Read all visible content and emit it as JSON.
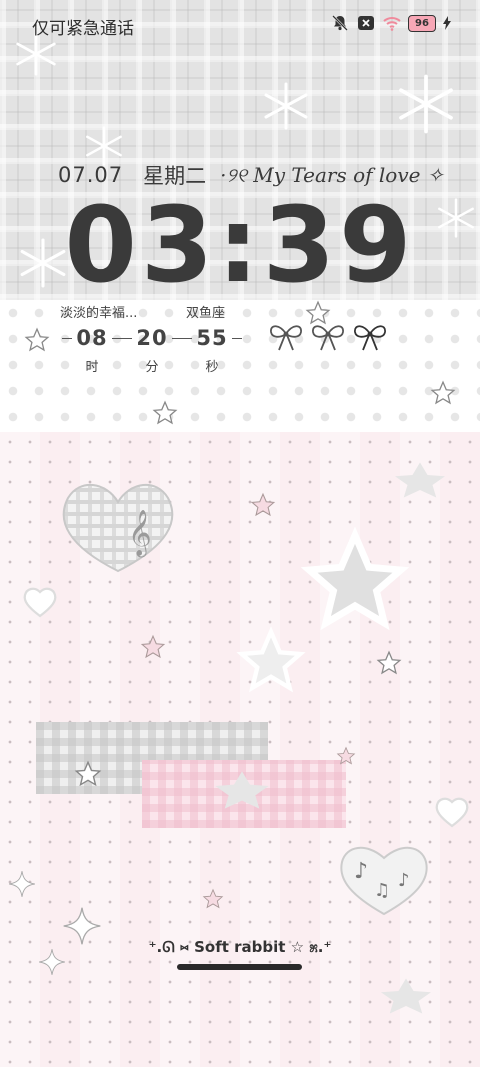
{
  "status_bar": {
    "left_text": "仅可紧急通话",
    "battery_level": "96",
    "icons": [
      "bell-muted-icon",
      "sim-off-icon",
      "wifi-icon",
      "battery-icon",
      "charging-icon"
    ]
  },
  "lockscreen": {
    "date": "07.07",
    "weekday": "星期二",
    "tagline": "·୨୧ My Tears of love ✧",
    "time": "03:39",
    "countdown": {
      "title": "淡淡的幸福...",
      "sign": "双鱼座",
      "hours": "08",
      "minutes": "20",
      "seconds": "55",
      "hours_unit": "时",
      "minutes_unit": "分",
      "seconds_unit": "秒"
    },
    "bottom_label": "⁺.ᘏ ⑅ Soft rabbit ☆ ೫.⁺"
  },
  "colors": {
    "top_plaid": "#e3e3e3",
    "dots_band": "#ffffff",
    "pink_bg": "#fbeef1",
    "text": "#3a3a3a"
  }
}
